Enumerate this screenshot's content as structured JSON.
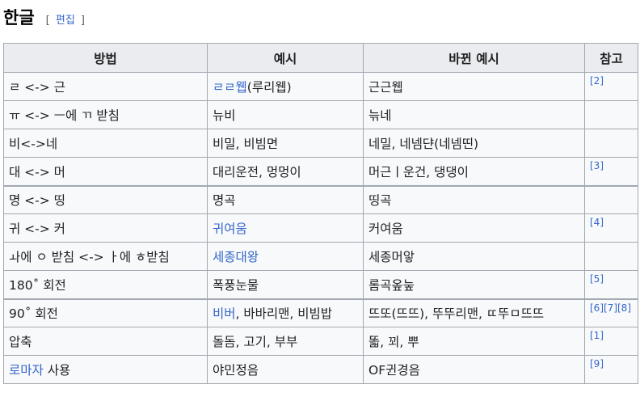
{
  "section": {
    "title": "한글",
    "edit_open": "[",
    "edit_label": "편집",
    "edit_close": "]"
  },
  "table": {
    "headers": [
      "방법",
      "예시",
      "바뀐 예시",
      "참고"
    ],
    "rows": [
      {
        "method": [
          {
            "t": "ㄹ <-> 근"
          }
        ],
        "example": [
          {
            "t": "ㄹㄹ웹",
            "link": true
          },
          {
            "t": "(루리웹)"
          }
        ],
        "changed": "근근웹",
        "ref": "[2]",
        "thick": false
      },
      {
        "method": [
          {
            "t": "ㅠ <-> ㅡ에 ㄲ 받침"
          }
        ],
        "example": [
          {
            "t": "뉴비"
          }
        ],
        "changed": "늒네",
        "ref": "",
        "thick": false
      },
      {
        "method": [
          {
            "t": "비<->네"
          }
        ],
        "example": [
          {
            "t": "비밀, 비빔면"
          }
        ],
        "changed": "네밀, 네넴댠(네넴띤)",
        "ref": "",
        "thick": false
      },
      {
        "method": [
          {
            "t": "대 <-> 머"
          }
        ],
        "example": [
          {
            "t": "대리운전, 멍멍이"
          }
        ],
        "changed": "머근ㅣ운건, 댕댕이",
        "ref": "[3]",
        "thick": false
      },
      {
        "method": [
          {
            "t": "명 <-> 띵"
          }
        ],
        "example": [
          {
            "t": "명곡"
          }
        ],
        "changed": "띵곡",
        "ref": "",
        "thick": true
      },
      {
        "method": [
          {
            "t": "귀 <-> 커"
          }
        ],
        "example": [
          {
            "t": "귀여움",
            "link": true
          }
        ],
        "changed": "커여움",
        "ref": "[4]",
        "thick": false
      },
      {
        "method": [
          {
            "t": "ㅘ에 ㅇ 받침 <-> ㅏ에 ㅎ받침"
          }
        ],
        "example": [
          {
            "t": "세종대왕",
            "link": true
          }
        ],
        "changed": "세종머앟",
        "ref": "",
        "thick": false
      },
      {
        "method": [
          {
            "t": "180˚ 회전"
          }
        ],
        "example": [
          {
            "t": "폭풍눈물"
          }
        ],
        "changed": "롬곡옾눞",
        "ref": "[5]",
        "thick": false
      },
      {
        "method": [
          {
            "t": "90˚ 회전"
          }
        ],
        "example": [
          {
            "t": "비버",
            "link": true
          },
          {
            "t": ", 바바리맨, 비빔밥"
          }
        ],
        "changed": "뜨또(뜨뜨), 뚜뚜리맨, ㄸ뚜ㅁ뜨뜨",
        "ref": "[6][7][8]",
        "thick": true
      },
      {
        "method": [
          {
            "t": "압축"
          }
        ],
        "example": [
          {
            "t": "돌돔, 고기, 부부"
          }
        ],
        "changed": "똛, 꾀, 뿌",
        "ref": "[1]",
        "thick": false
      },
      {
        "method": [
          {
            "t": "로마자",
            "link": true
          },
          {
            "t": " 사용"
          }
        ],
        "example": [
          {
            "t": "야민정음"
          }
        ],
        "changed": "OF귄경음",
        "ref": "[9]",
        "thick": false
      }
    ]
  }
}
